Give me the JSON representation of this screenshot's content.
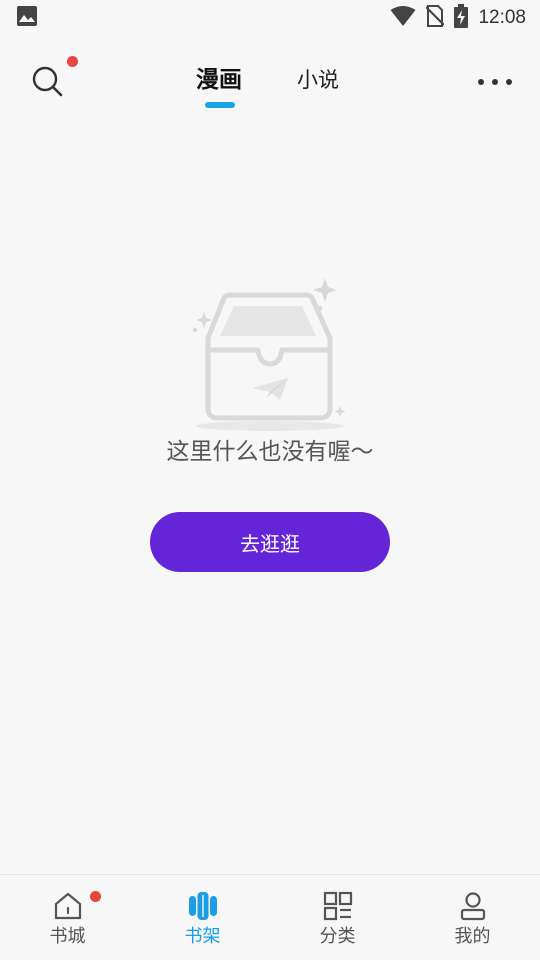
{
  "status_bar": {
    "time": "12:08",
    "icons": [
      "image-icon",
      "wifi-icon",
      "no-sim-icon",
      "battery-charging-icon"
    ]
  },
  "header": {
    "tabs": [
      {
        "label": "漫画",
        "active": true
      },
      {
        "label": "小说",
        "active": false
      }
    ],
    "search_has_badge": true
  },
  "empty_state": {
    "message": "这里什么也没有喔～",
    "button_label": "去逛逛"
  },
  "bottom_nav": {
    "items": [
      {
        "label": "书城",
        "icon": "home-icon",
        "badge": true
      },
      {
        "label": "书架",
        "icon": "bookshelf-icon",
        "active": true
      },
      {
        "label": "分类",
        "icon": "category-icon"
      },
      {
        "label": "我的",
        "icon": "profile-icon"
      }
    ]
  },
  "colors": {
    "accent_blue": "#1aa3e8",
    "button_purple": "#6424d8",
    "badge_red": "#e8453c",
    "background": "#f7f7f7"
  }
}
